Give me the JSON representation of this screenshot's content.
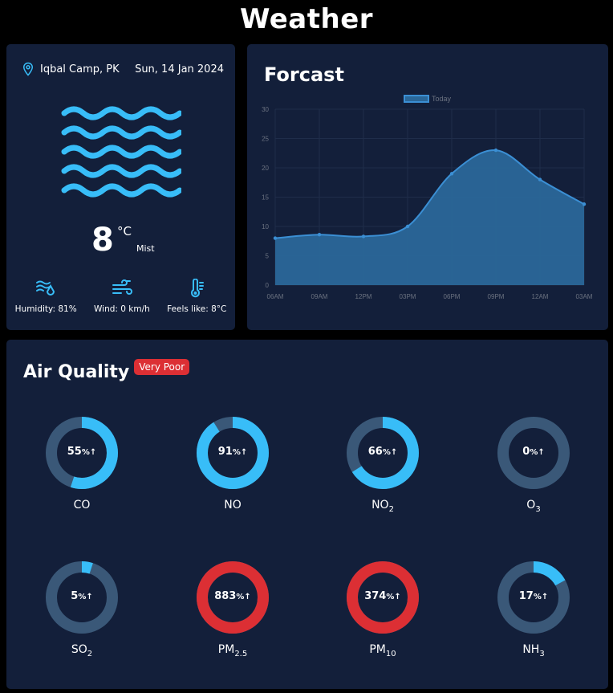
{
  "page_title": "Weather",
  "current": {
    "location": "Iqbal Camp, PK",
    "date": "Sun, 14 Jan 2024",
    "temperature": "8",
    "unit": "°C",
    "description": "Mist",
    "stats": [
      {
        "label": "Humidity: 81%",
        "icon": "humidity-icon"
      },
      {
        "label": "Wind: 0 km/h",
        "icon": "wind-icon"
      },
      {
        "label": "Feels like: 8°C",
        "icon": "thermometer-icon"
      }
    ]
  },
  "forecast": {
    "title": "Forcast",
    "chart_data": {
      "type": "area",
      "categories": [
        "06AM",
        "09AM",
        "12PM",
        "03PM",
        "06PM",
        "09PM",
        "12AM",
        "03AM"
      ],
      "series": [
        {
          "name": "Today",
          "values": [
            8,
            8.6,
            8.3,
            10,
            19,
            23,
            18,
            13.8
          ]
        }
      ],
      "ylim": [
        0,
        30
      ],
      "yticks": [
        0,
        5,
        10,
        15,
        20,
        25,
        30
      ],
      "legend": "top-center",
      "grid": true
    }
  },
  "air_quality": {
    "title": "Air Quality",
    "status": "Very Poor",
    "pollutants": [
      {
        "name": "CO",
        "sub": "",
        "value": "55",
        "fill": 0.55,
        "color": "#38bdf8"
      },
      {
        "name": "NO",
        "sub": "",
        "value": "91",
        "fill": 0.91,
        "color": "#38bdf8"
      },
      {
        "name": "NO",
        "sub": "2",
        "value": "66",
        "fill": 0.66,
        "color": "#38bdf8"
      },
      {
        "name": "O",
        "sub": "3",
        "value": "0",
        "fill": 0.0,
        "color": "#38bdf8"
      },
      {
        "name": "SO",
        "sub": "2",
        "value": "5",
        "fill": 0.05,
        "color": "#38bdf8"
      },
      {
        "name": "PM",
        "sub": "2.5",
        "value": "883",
        "fill": 1.0,
        "color": "#dc2f34"
      },
      {
        "name": "PM",
        "sub": "10",
        "value": "374",
        "fill": 1.0,
        "color": "#dc2f34"
      },
      {
        "name": "NH",
        "sub": "3",
        "value": "17",
        "fill": 0.17,
        "color": "#38bdf8"
      }
    ],
    "unit_suffix": "%",
    "arrow": "↑"
  },
  "colors": {
    "accent": "#38bdf8",
    "card": "#131f3a",
    "danger": "#dc2f34",
    "track": "#3a5878"
  }
}
